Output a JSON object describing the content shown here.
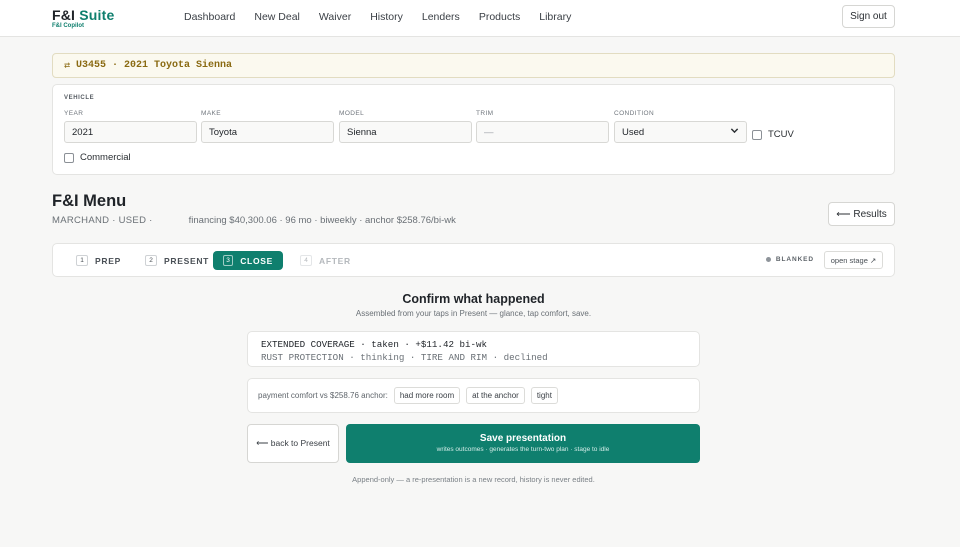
{
  "brand": {
    "name_part1": "F&I",
    "name_part2": "Suite",
    "sub": "F&I Copilot"
  },
  "nav": {
    "items": [
      "Dashboard",
      "New Deal",
      "Waiver",
      "History",
      "Lenders",
      "Products",
      "Library"
    ]
  },
  "header": {
    "signout_label": "Sign out"
  },
  "deal": {
    "swap_icon": "⇄",
    "text": "U3455 · 2021 Toyota Sienna"
  },
  "vehicle": {
    "section_label": "VEHICLE",
    "year_label": "YEAR",
    "year_value": "2021",
    "make_label": "MAKE",
    "make_value": "Toyota",
    "model_label": "MODEL",
    "model_value": "Sienna",
    "trim_label": "TRIM",
    "trim_placeholder": "—",
    "condition_label": "CONDITION",
    "condition_value": "Used",
    "tcuv_label": "TCUV",
    "tcuv_checked": false,
    "commercial_label": "Commercial",
    "commercial_checked": false
  },
  "menu": {
    "title": "F&I Menu",
    "meta_caps": "MARCHAND · USED ·",
    "meta_text": "financing $40,300.06 · 96 mo · biweekly · anchor $258.76/bi-wk",
    "results_label": "⟵ Results"
  },
  "stages": {
    "items": [
      {
        "num": "1",
        "label": "PREP",
        "state": "done"
      },
      {
        "num": "2",
        "label": "PRESENT",
        "state": "done"
      },
      {
        "num": "3",
        "label": "CLOSE",
        "state": "active"
      },
      {
        "num": "4",
        "label": "AFTER",
        "state": "upcoming"
      }
    ],
    "blanked_label": "BLANKED",
    "open_stage_label": "open stage ↗"
  },
  "confirm": {
    "title": "Confirm what happened",
    "subtitle": "Assembled from your taps in Present — glance, tap comfort, save.",
    "summary_line1": "EXTENDED COVERAGE · taken · +$11.42 bi-wk",
    "summary_line2": "RUST PROTECTION · thinking · TIRE AND RIM · declined",
    "comfort_label": "payment comfort vs $258.76 anchor:",
    "comfort_options": [
      "had more room",
      "at the anchor",
      "tight"
    ],
    "back_label": "⟵ back to Present",
    "save_label": "Save presentation",
    "save_sub": "writes outcomes · generates the turn-two plan · stage to idle",
    "footnote": "Append-only — a re-presentation is a new record, history is never edited."
  },
  "colors": {
    "accent": "#0f7f6e",
    "deal_text": "#8a6a12",
    "deal_bg": "#fbf9ef"
  }
}
